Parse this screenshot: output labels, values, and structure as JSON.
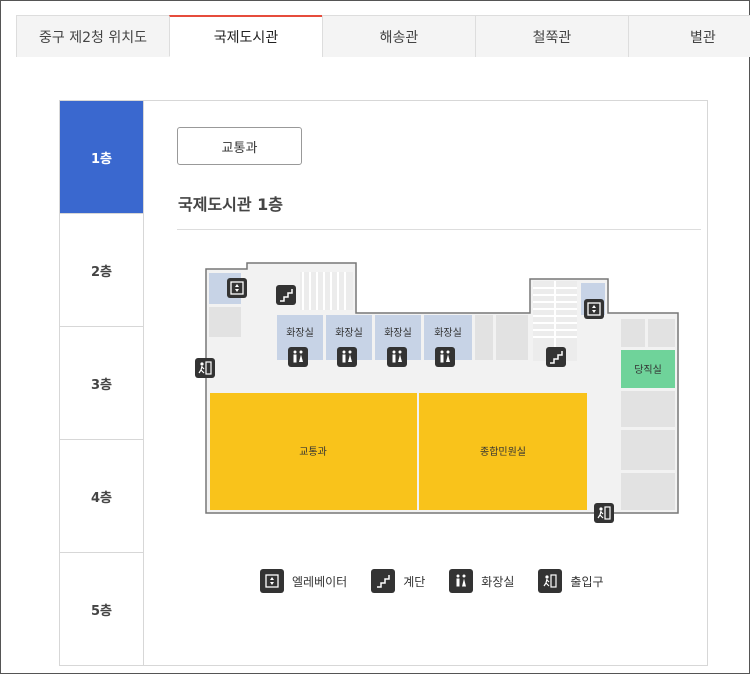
{
  "tabs": [
    {
      "label": "중구 제2청 위치도",
      "active": false
    },
    {
      "label": "국제도시관",
      "active": true
    },
    {
      "label": "해송관",
      "active": false
    },
    {
      "label": "철쭉관",
      "active": false
    },
    {
      "label": "별관",
      "active": false
    }
  ],
  "floors": [
    {
      "label": "1층",
      "active": true
    },
    {
      "label": "2층",
      "active": false
    },
    {
      "label": "3층",
      "active": false
    },
    {
      "label": "4층",
      "active": false
    },
    {
      "label": "5층",
      "active": false
    }
  ],
  "department_button": "교통과",
  "floor_title": "국제도시관 1층",
  "map": {
    "restrooms": [
      "화장실",
      "화장실",
      "화장실",
      "화장실"
    ],
    "office_left": "교통과",
    "office_right": "종합민원실",
    "duty_room": "당직실",
    "colors": {
      "office": "#f9c31b",
      "restroom": "#c7d3e6",
      "duty": "#6fd39a",
      "room_gray": "#e2e2e2",
      "wall": "#777777"
    }
  },
  "legend": [
    {
      "icon": "elevator-icon",
      "label": "엘레베이터"
    },
    {
      "icon": "stairs-icon",
      "label": "계단"
    },
    {
      "icon": "restroom-icon",
      "label": "화장실"
    },
    {
      "icon": "exit-icon",
      "label": "출입구"
    }
  ],
  "accent": {
    "active_floor": "#3a68cf",
    "active_tab_border": "#e64c3c"
  }
}
